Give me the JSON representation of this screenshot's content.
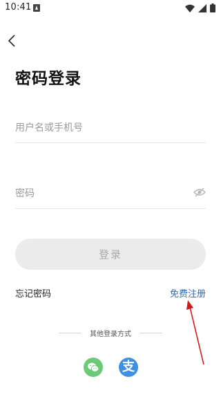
{
  "status_bar": {
    "time": "10:41"
  },
  "header": {
    "title": "密码登录"
  },
  "form": {
    "username_placeholder": "用户名或手机号",
    "password_placeholder": "密码"
  },
  "actions": {
    "login_label": "登录",
    "forgot_label": "忘记密码",
    "register_label": "免费注册"
  },
  "other_login": {
    "label": "其他登录方式",
    "providers": [
      {
        "name": "wechat",
        "icon": "wechat-icon",
        "color": "#6cc978"
      },
      {
        "name": "alipay",
        "icon": "alipay-icon",
        "glyph": "支",
        "color": "#3f90e2"
      }
    ]
  },
  "colors": {
    "register_link": "#2f6ab2",
    "annotation_arrow": "#d11a1a",
    "login_button_bg": "#ebebeb"
  }
}
